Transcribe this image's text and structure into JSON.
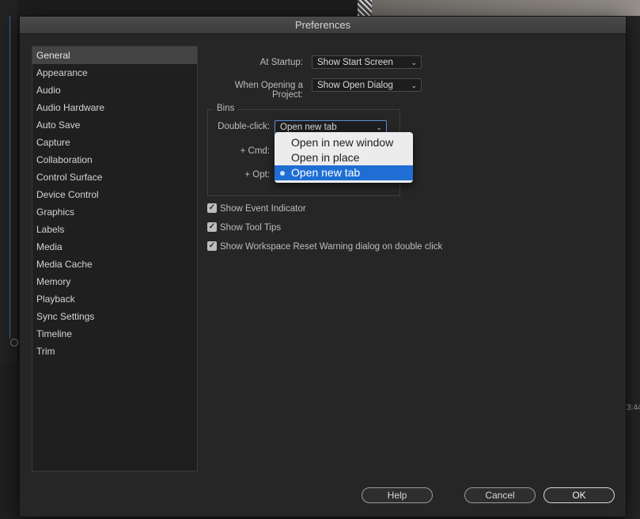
{
  "dialog": {
    "title": "Preferences"
  },
  "sidebar": {
    "items": [
      {
        "label": "General",
        "selected": true
      },
      {
        "label": "Appearance"
      },
      {
        "label": "Audio"
      },
      {
        "label": "Audio Hardware"
      },
      {
        "label": "Auto Save"
      },
      {
        "label": "Capture"
      },
      {
        "label": "Collaboration"
      },
      {
        "label": "Control Surface"
      },
      {
        "label": "Device Control"
      },
      {
        "label": "Graphics"
      },
      {
        "label": "Labels"
      },
      {
        "label": "Media"
      },
      {
        "label": "Media Cache"
      },
      {
        "label": "Memory"
      },
      {
        "label": "Playback"
      },
      {
        "label": "Sync Settings"
      },
      {
        "label": "Timeline"
      },
      {
        "label": "Trim"
      }
    ]
  },
  "general": {
    "startup_label": "At Startup:",
    "startup_value": "Show Start Screen",
    "opening_label": "When Opening a Project:",
    "opening_value": "Show Open Dialog",
    "bins": {
      "title": "Bins",
      "double_click_label": "Double-click:",
      "double_click_value": "Open new tab",
      "cmd_label": "+ Cmd:",
      "opt_label": "+ Opt:",
      "popup_options": [
        "Open in new window",
        "Open in place",
        "Open new tab"
      ]
    },
    "checkboxes": [
      {
        "label": "Show Event Indicator",
        "checked": true
      },
      {
        "label": "Show Tool Tips",
        "checked": true
      },
      {
        "label": "Show Workspace Reset Warning dialog on double click",
        "checked": true
      }
    ]
  },
  "buttons": {
    "help": "Help",
    "cancel": "Cancel",
    "ok": "OK"
  },
  "background": {
    "timecode_fragment": "3:44"
  },
  "icons": {
    "dropdown": "chevron-down-icon",
    "check": "checkmark-icon",
    "selected": "radio-dot-icon"
  },
  "colors": {
    "selection": "#1f6ed4",
    "dialog_bg": "#262626"
  }
}
